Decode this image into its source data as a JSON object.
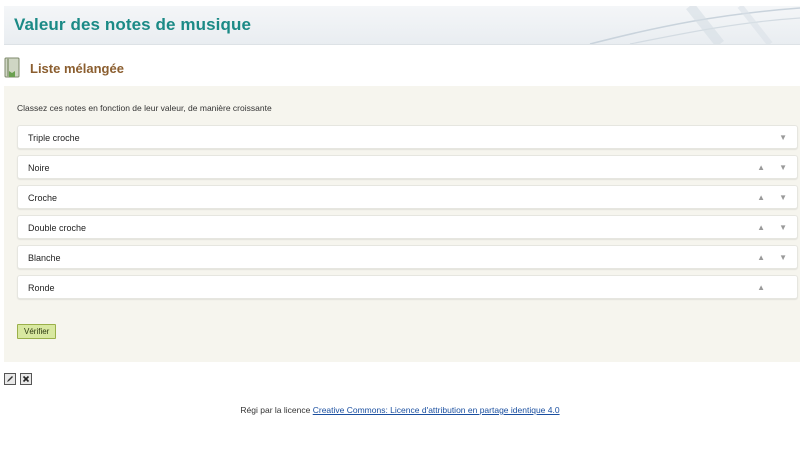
{
  "header": {
    "title": "Valeur des notes de musique"
  },
  "section": {
    "icon": "book-icon",
    "title": "Liste mélangée"
  },
  "activity": {
    "instruction": "Classez ces notes en fonction de leur valeur, de manière croissante",
    "items": [
      {
        "label": "Triple croche",
        "up": false,
        "down": true
      },
      {
        "label": "Noire",
        "up": true,
        "down": true
      },
      {
        "label": "Croche",
        "up": true,
        "down": true
      },
      {
        "label": "Double croche",
        "up": true,
        "down": true
      },
      {
        "label": "Blanche",
        "up": true,
        "down": true
      },
      {
        "label": "Ronde",
        "up": true,
        "down": false
      }
    ],
    "up_arrow": "▲",
    "down_arrow": "▼",
    "check_label": "Vérifier"
  },
  "tools": {
    "edit_icon": "pencil-icon",
    "delete_icon": "delete-icon"
  },
  "footer": {
    "prefix": "Régi par la licence",
    "link_text": "Creative Commons: Licence d'attribution en partage identique 4.0"
  },
  "colors": {
    "title": "#1b8a86",
    "section_title": "#8b5e2f",
    "panel_bg": "#f6f5ee",
    "button_bg": "#d8e8a0",
    "link": "#1a4fa0"
  }
}
